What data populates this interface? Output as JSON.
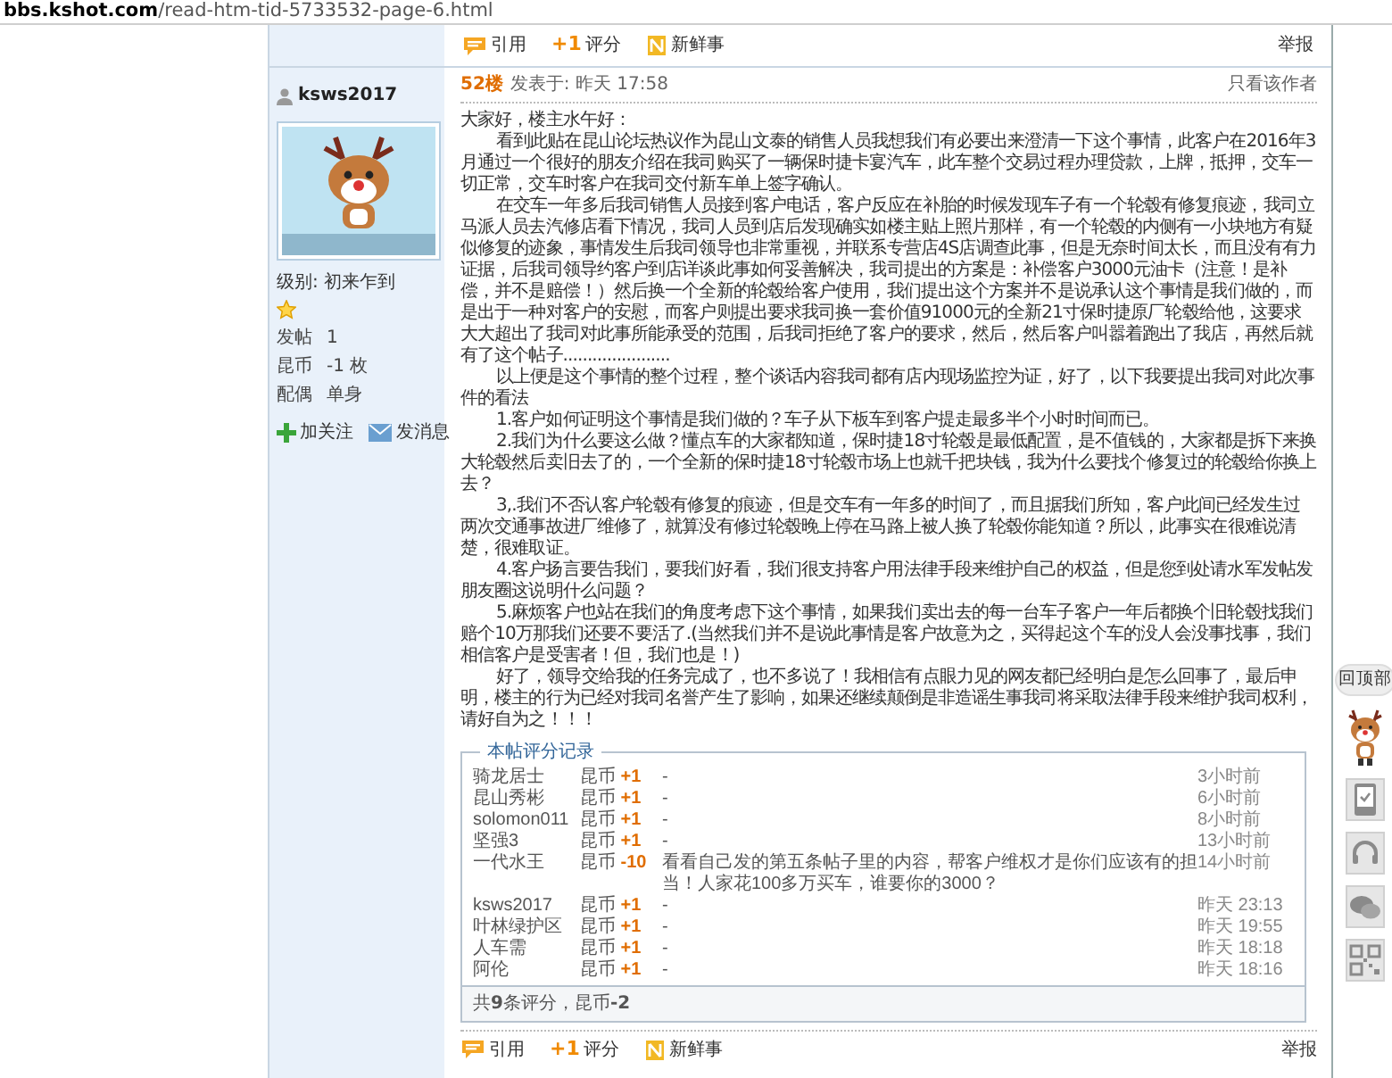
{
  "address_bar": {
    "host": "bbs.kshot.com",
    "path": "/read-htm-tid-5733532-page-6.html"
  },
  "top_actions": [
    {
      "kind": "quote",
      "label": "引用"
    },
    {
      "kind": "rate",
      "badge": "+1",
      "label": "评分"
    },
    {
      "kind": "share",
      "label": "新鲜事"
    }
  ],
  "top_report": "举报",
  "author": {
    "username": "ksws2017",
    "level": "级别: 初来乍到",
    "stats": [
      {
        "label": "发帖",
        "value": "1"
      },
      {
        "label": "昆币",
        "value": "-1 枚"
      },
      {
        "label": "配偶",
        "value": "单身"
      }
    ],
    "actions": [
      {
        "kind": "follow",
        "label": "加关注"
      },
      {
        "kind": "message",
        "label": "发消息"
      }
    ]
  },
  "post": {
    "floor": "52楼",
    "posted": "发表于: 昨天 17:58",
    "author_only": "只看该作者",
    "paragraphs": [
      {
        "indent": false,
        "text": "大家好，楼主水午好："
      },
      {
        "indent": true,
        "text": "看到此贴在昆山论坛热议作为昆山文泰的销售人员我想我们有必要出来澄清一下这个事情，此客户在2016年3月通过一个很好的朋友介绍在我司购买了一辆保时捷卡宴汽车，此车整个交易过程办理贷款，上牌，抵押，交车一切正常，交车时客户在我司交付新车单上签字确认。"
      },
      {
        "indent": true,
        "text": "在交车一年多后我司销售人员接到客户电话，客户反应在补胎的时候发现车子有一个轮毂有修复痕迹，我司立马派人员去汽修店看下情况，我司人员到店后发现确实如楼主贴上照片那样，有一个轮毂的内侧有一小块地方有疑似修复的迹象，事情发生后我司领导也非常重视，并联系专营店4S店调查此事，但是无奈时间太长，而且没有有力证据，后我司领导约客户到店详谈此事如何妥善解决，我司提出的方案是：补偿客户3000元油卡（注意！是补偿，并不是赔偿！）然后换一个全新的轮毂给客户使用，我们提出这个方案并不是说承认这个事情是我们做的，而是出于一种对客户的安慰，而客户则提出要求我司换一套价值91000元的全新21寸保时捷原厂轮毂给他，这要求大大超出了我司对此事所能承受的范围，后我司拒绝了客户的要求，然后，然后客户叫嚣着跑出了我店，再然后就有了这个帖子......................"
      },
      {
        "indent": true,
        "text": "以上便是这个事情的整个过程，整个谈话内容我司都有店内现场监控为证，好了，以下我要提出我司对此次事件的看法"
      },
      {
        "indent": true,
        "text": "1.客户如何证明这个事情是我们做的？车子从下板车到客户提走最多半个小时时间而已。"
      },
      {
        "indent": true,
        "text": "2.我们为什么要这么做？懂点车的大家都知道，保时捷18寸轮毂是最低配置，是不值钱的，大家都是拆下来换大轮毂然后卖旧去了的，一个全新的保时捷18寸轮毂市场上也就千把块钱，我为什么要找个修复过的轮毂给你换上去？"
      },
      {
        "indent": true,
        "text": "3,.我们不否认客户轮毂有修复的痕迹，但是交车有一年多的时间了，而且据我们所知，客户此间已经发生过两次交通事故进厂维修了，就算没有修过轮毂晚上停在马路上被人换了轮毂你能知道？所以，此事实在很难说清楚，很难取证。"
      },
      {
        "indent": true,
        "text": "4.客户扬言要告我们，要我们好看，我们很支持客户用法律手段来维护自己的权益，但是您到处请水军发帖发朋友圈这说明什么问题？"
      },
      {
        "indent": true,
        "text": "5.麻烦客户也站在我们的角度考虑下这个事情，如果我们卖出去的每一台车子客户一年后都换个旧轮毂找我们赔个10万那我们还要不要活了.(当然我们并不是说此事情是客户故意为之，买得起这个车的没人会没事找事，我们相信客户是受害者！但，我们也是！)"
      },
      {
        "indent": true,
        "text": "好了，领导交给我的任务完成了，也不多说了！我相信有点眼力见的网友都已经明白是怎么回事了，最后申明，楼主的行为已经对我司名誉产生了影响，如果还继续颠倒是非造谣生事我司将采取法律手段来维护我司权利，请好自为之！！！"
      }
    ]
  },
  "ratings": {
    "title": "本帖评分记录",
    "rows": [
      {
        "user": "骑龙居士",
        "currency": "昆币",
        "delta": "+1",
        "reason": "-",
        "time": "3小时前"
      },
      {
        "user": "昆山秀彬",
        "currency": "昆币",
        "delta": "+1",
        "reason": "-",
        "time": "6小时前"
      },
      {
        "user": "solomon011",
        "currency": "昆币",
        "delta": "+1",
        "reason": "-",
        "time": "8小时前"
      },
      {
        "user": "坚强3",
        "currency": "昆币",
        "delta": "+1",
        "reason": "-",
        "time": "13小时前"
      },
      {
        "user": "一代水王",
        "currency": "昆币",
        "delta": "-10",
        "reason": "看看自己发的第五条帖子里的内容，帮客户维权才是你们应该有的担当！人家花100多万买车，谁要你的3000？",
        "time": "14小时前"
      },
      {
        "user": "ksws2017",
        "currency": "昆币",
        "delta": "+1",
        "reason": "-",
        "time": "昨天 23:13"
      },
      {
        "user": "叶林绿护区",
        "currency": "昆币",
        "delta": "+1",
        "reason": "-",
        "time": "昨天 19:55"
      },
      {
        "user": "人车需",
        "currency": "昆币",
        "delta": "+1",
        "reason": "-",
        "time": "昨天 18:18"
      },
      {
        "user": "阿伦",
        "currency": "昆币",
        "delta": "+1",
        "reason": "-",
        "time": "昨天 18:16"
      }
    ],
    "summary": "共**9**条评分，昆币**-2**"
  },
  "bottom_actions": [
    {
      "kind": "quote",
      "label": "引用"
    },
    {
      "kind": "rate",
      "badge": "+1",
      "label": "评分"
    },
    {
      "kind": "share",
      "label": "新鲜事"
    }
  ],
  "bottom_report": "举报",
  "side_tools": {
    "back_to_top": "回顶部",
    "icons": [
      {
        "kind": "mascot"
      },
      {
        "kind": "phone"
      },
      {
        "kind": "headset"
      },
      {
        "kind": "chat"
      },
      {
        "kind": "qr"
      }
    ]
  }
}
